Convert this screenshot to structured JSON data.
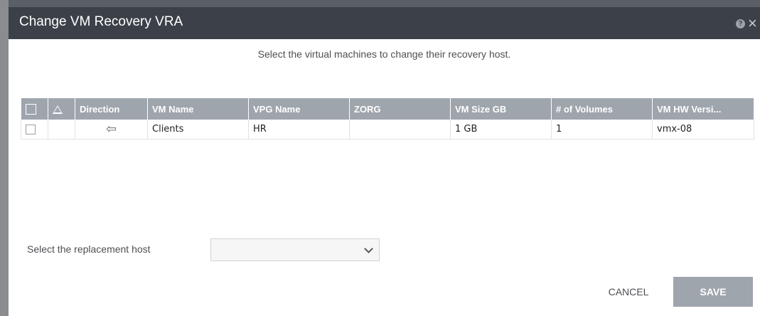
{
  "dialog": {
    "title": "Change VM Recovery VRA",
    "help_glyph": "?",
    "close_glyph": "×",
    "instruction": "Select the virtual machines to change their recovery host."
  },
  "table": {
    "columns": [
      "Direction",
      "VM Name",
      "VPG Name",
      "ZORG",
      "VM Size GB",
      "# of Volumes",
      "VM HW Versi..."
    ],
    "rows": [
      {
        "direction_glyph": "⇦",
        "vm_name": "Clients",
        "vpg_name": "HR",
        "zorg": "",
        "vm_size": "1 GB",
        "volumes": "1",
        "hw_version": "vmx-08"
      }
    ]
  },
  "replacement_host": {
    "label": "Select the replacement host",
    "selected": ""
  },
  "actions": {
    "cancel_label": "CANCEL",
    "save_label": "SAVE"
  },
  "colors": {
    "titlebar": "#3c4149",
    "header": "#9fa5ad",
    "save_button": "#9fa5ad"
  }
}
